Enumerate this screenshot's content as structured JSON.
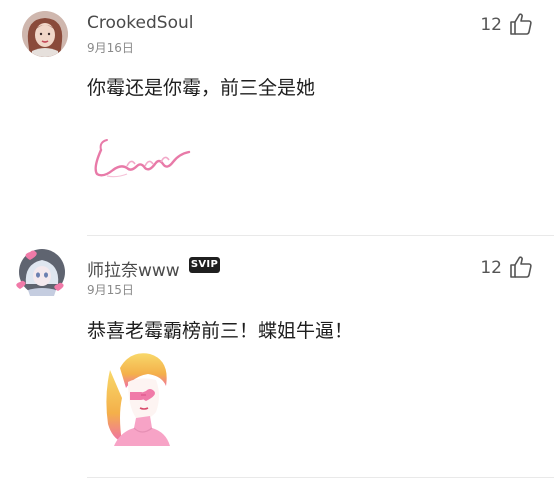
{
  "comments": [
    {
      "username": "CrookedSoul",
      "date": "9月16日",
      "likes": "12",
      "text": "你霉还是你霉，前三全是她",
      "avatar_icon": "user-avatar-photo",
      "sticker": "lover-script-sticker",
      "sticker_text": "Lover"
    },
    {
      "username": "师拉奈www",
      "badge": "SVIP",
      "date": "9月15日",
      "likes": "12",
      "text": "恭喜老霉霸榜前三！蝶姐牛逼！",
      "avatar_icon": "user-avatar-illustration",
      "sticker": "blonde-girl-heart-glasses-sticker"
    }
  ],
  "colors": {
    "accent_pink": "#e87aa8",
    "text_primary": "#1e1e1e",
    "text_secondary": "#8a8a8a",
    "badge_bg": "#1f1f1f"
  },
  "icons": {
    "like": "thumbs-up-icon"
  }
}
